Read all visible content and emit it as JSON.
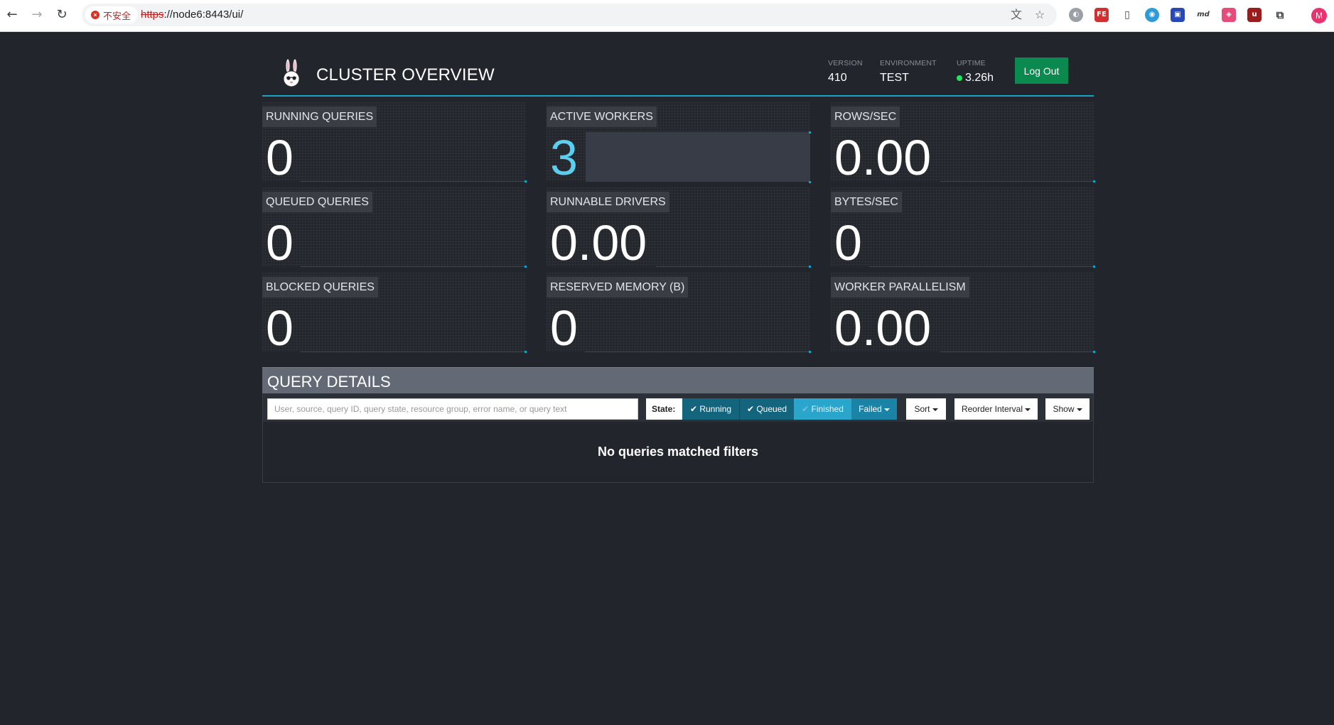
{
  "browser": {
    "security_label": "不安全",
    "url_scheme": "https",
    "url_rest": "://node6:8443/ui/",
    "profile_initial": "M",
    "extensions": [
      "translate-icon",
      "star-icon",
      "cookie-ext-icon",
      "fe-ext-icon",
      "bookmark-icon",
      "globe-ext-icon",
      "blue-ext-icon",
      "md-ext-icon",
      "red-ext-icon",
      "ublock-icon",
      "puzzle-icon"
    ]
  },
  "header": {
    "title": "CLUSTER OVERVIEW",
    "version_label": "VERSION",
    "version_value": "410",
    "environment_label": "ENVIRONMENT",
    "environment_value": "TEST",
    "uptime_label": "UPTIME",
    "uptime_value": "3.26h",
    "logout_label": "Log Out"
  },
  "stats": {
    "running_queries": {
      "label": "RUNNING QUERIES",
      "value": "0"
    },
    "active_workers": {
      "label": "ACTIVE WORKERS",
      "value": "3"
    },
    "rows_sec": {
      "label": "ROWS/SEC",
      "value": "0.00"
    },
    "queued_queries": {
      "label": "QUEUED QUERIES",
      "value": "0"
    },
    "runnable_drivers": {
      "label": "RUNNABLE DRIVERS",
      "value": "0.00"
    },
    "bytes_sec": {
      "label": "BYTES/SEC",
      "value": "0"
    },
    "blocked_queries": {
      "label": "BLOCKED QUERIES",
      "value": "0"
    },
    "reserved_memory": {
      "label": "RESERVED MEMORY (B)",
      "value": "0"
    },
    "worker_parallelism": {
      "label": "WORKER PARALLELISM",
      "value": "0.00"
    }
  },
  "query_details": {
    "title": "QUERY DETAILS",
    "search_placeholder": "User, source, query ID, query state, resource group, error name, or query text",
    "state_label": "State:",
    "running_label": "Running",
    "queued_label": "Queued",
    "finished_label": "Finished",
    "failed_label": "Failed",
    "sort_label": "Sort",
    "reorder_label": "Reorder Interval",
    "show_label": "Show",
    "empty_message": "No queries matched filters"
  },
  "colors": {
    "background": "#22252b",
    "accent": "#1ba1c4",
    "logout": "#0a8a4f",
    "highlight_value": "#5bcff0"
  }
}
